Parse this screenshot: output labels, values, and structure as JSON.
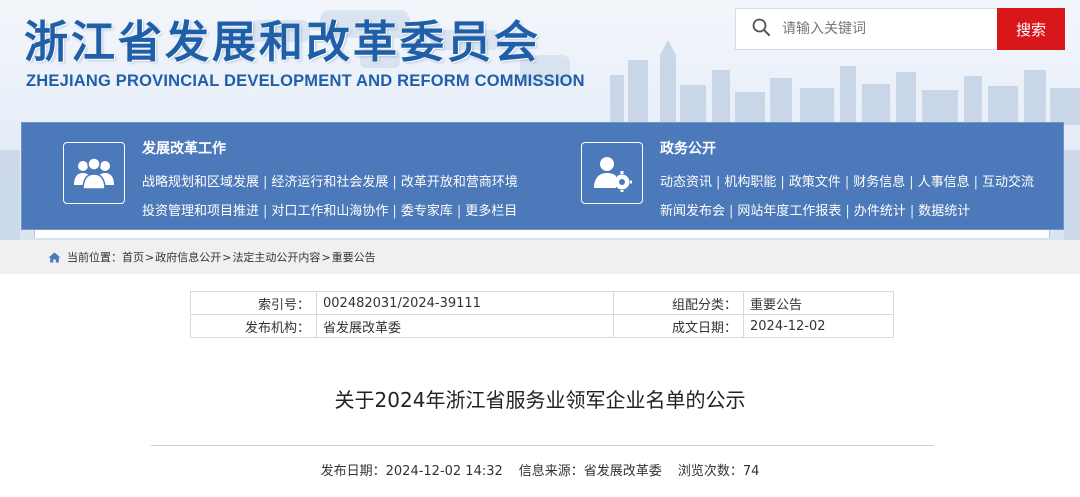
{
  "header": {
    "title": "浙江省发展和改革委员会",
    "subtitle": "ZHEJIANG PROVINCIAL DEVELOPMENT AND REFORM COMMISSION"
  },
  "search": {
    "placeholder": "请输入关键词",
    "button_label": "搜索"
  },
  "nav": {
    "groups": [
      {
        "heading": "发展改革工作",
        "icon": "people-group-icon",
        "rows": [
          [
            "战略规划和区域发展",
            "经济运行和社会发展",
            "改革开放和营商环境"
          ],
          [
            "投资管理和项目推进",
            "对口工作和山海协作",
            "委专家库",
            "更多栏目"
          ]
        ]
      },
      {
        "heading": "政务公开",
        "icon": "user-gear-icon",
        "rows": [
          [
            "动态资讯",
            "机构职能",
            "政策文件",
            "财务信息",
            "人事信息",
            "互动交流"
          ],
          [
            "新闻发布会",
            "网站年度工作报表",
            "办件统计",
            "数据统计"
          ]
        ]
      }
    ]
  },
  "breadcrumb": {
    "prefix": "当前位置：",
    "items": [
      "首页",
      "政府信息公开",
      "法定主动公开内容",
      "重要公告"
    ],
    "separator": ">"
  },
  "meta": {
    "index_label": "索引号：",
    "index_value": "002482031/2024-39111",
    "category_label": "组配分类：",
    "category_value": "重要公告",
    "publisher_label": "发布机构：",
    "publisher_value": "省发展改革委",
    "date_label": "成文日期：",
    "date_value": "2024-12-02"
  },
  "article": {
    "title": "关于2024年浙江省服务业领军企业名单的公示",
    "publish_label": "发布日期：",
    "publish_value": "2024-12-02 14:32",
    "source_label": "信息来源：",
    "source_value": "省发展改革委",
    "views_label": "浏览次数：",
    "views_value": "74"
  },
  "colors": {
    "brand_blue": "#1f5fa8",
    "nav_blue": "#4c79b9",
    "search_red": "#d9171b"
  }
}
